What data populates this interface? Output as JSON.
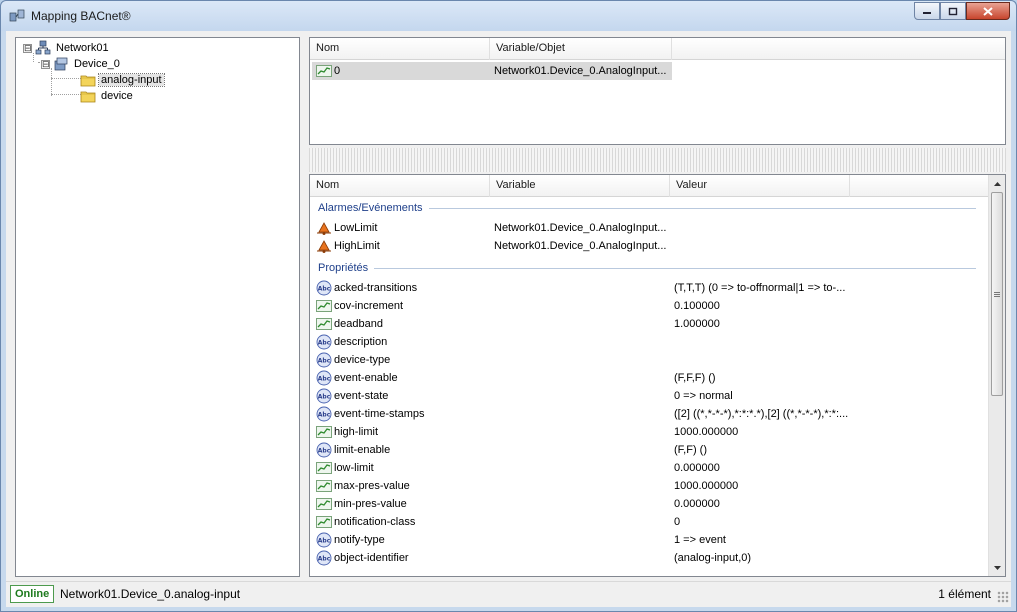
{
  "window": {
    "title": "Mapping BACnet®"
  },
  "tree": {
    "nodes": [
      {
        "label": "Network01",
        "expander": "⊟"
      },
      {
        "label": "Device_0",
        "expander": "⊟"
      },
      {
        "label": "analog-input"
      },
      {
        "label": "device"
      }
    ]
  },
  "top_table": {
    "headers": [
      "Nom",
      "Variable/Objet"
    ],
    "rows": [
      {
        "nom": "0",
        "variable": "Network01.Device_0.AnalogInput..."
      }
    ]
  },
  "bottom_table": {
    "headers": [
      "Nom",
      "Variable",
      "Valeur"
    ],
    "groups": {
      "alarms": "Alarmes/Evénements",
      "props": "Propriétés"
    },
    "alarms": [
      {
        "nom": "LowLimit",
        "variable": "Network01.Device_0.AnalogInput...",
        "icon": "alarm-bell-icon"
      },
      {
        "nom": "HighLimit",
        "variable": "Network01.Device_0.AnalogInput...",
        "icon": "alarm-bell-icon"
      }
    ],
    "props": [
      {
        "nom": "acked-transitions",
        "valeur": "(T,T,T)  (0 => to-offnormal|1 => to-...",
        "icon": "abc-icon"
      },
      {
        "nom": "cov-increment",
        "valeur": "0.100000",
        "icon": "analog-icon"
      },
      {
        "nom": "deadband",
        "valeur": "1.000000",
        "icon": "analog-icon"
      },
      {
        "nom": "description",
        "valeur": "",
        "icon": "abc-icon"
      },
      {
        "nom": "device-type",
        "valeur": "",
        "icon": "abc-icon"
      },
      {
        "nom": "event-enable",
        "valeur": "(F,F,F) ()",
        "icon": "abc-icon"
      },
      {
        "nom": "event-state",
        "valeur": "0 => normal",
        "icon": "abc-icon"
      },
      {
        "nom": "event-time-stamps",
        "valeur": "([2]  ((*,*-*-*),*:*:*.*),[2]  ((*,*-*-*),*:*:...",
        "icon": "abc-icon"
      },
      {
        "nom": "high-limit",
        "valeur": "1000.000000",
        "icon": "analog-icon"
      },
      {
        "nom": "limit-enable",
        "valeur": "(F,F) ()",
        "icon": "abc-icon"
      },
      {
        "nom": "low-limit",
        "valeur": "0.000000",
        "icon": "analog-icon"
      },
      {
        "nom": "max-pres-value",
        "valeur": "1000.000000",
        "icon": "analog-icon"
      },
      {
        "nom": "min-pres-value",
        "valeur": "0.000000",
        "icon": "analog-icon"
      },
      {
        "nom": "notification-class",
        "valeur": "0",
        "icon": "analog-icon"
      },
      {
        "nom": "notify-type",
        "valeur": "1 => event",
        "icon": "abc-icon"
      },
      {
        "nom": "object-identifier",
        "valeur": "(analog-input,0)",
        "icon": "abc-icon"
      }
    ]
  },
  "status": {
    "online": "Online",
    "path": "Network01.Device_0.analog-input",
    "count": "1 élément"
  },
  "colors": {
    "group": "#1e3f8a",
    "online": "#1d7a1d"
  }
}
